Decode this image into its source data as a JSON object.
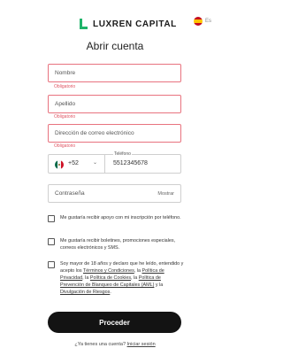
{
  "header": {
    "brand": "LUXREN CAPITAL",
    "language": "Es"
  },
  "form": {
    "title": "Abrir cuenta",
    "first_name": {
      "placeholder": "Nombre",
      "error": "Obligatorio"
    },
    "last_name": {
      "placeholder": "Apellido",
      "error": "Obligatorio"
    },
    "email": {
      "placeholder": "Dirección de correo electrónico",
      "error": "Obligatorio"
    },
    "phone": {
      "country_code": "+52",
      "label": "Teléfono",
      "value": "5512345678"
    },
    "password": {
      "placeholder": "Contraseña",
      "toggle": "Mostrar"
    },
    "checkbox_1": {
      "text": "Me gustaría recibir apoyo con mi inscripción por teléfono.",
      "checked": false
    },
    "checkbox_2": {
      "text": "Me gustaría recibir boletines, promociones especiales, correos electrónicos y SMS.",
      "checked": false
    },
    "checkbox_3": {
      "checked": false,
      "part1": "Soy mayor de 18 años y declaro que he leído, entendido y acepto los ",
      "link_terms": "Términos y Condiciones",
      "part2": ", la ",
      "link_privacy": "Política de Privacidad",
      "part3": ", la ",
      "link_cookies": "Política de Cookies",
      "part4": ", la ",
      "link_aml": "Política de Prevención de Blanqueo de Capitales (AML)",
      "part5": " y la ",
      "link_risk": "Divulgación de Riesgos",
      "part6": "."
    },
    "submit": "Proceder"
  },
  "footer": {
    "question": "¿Ya tienes una cuenta?",
    "login": "Iniciar sesión"
  },
  "colors": {
    "brand_green": "#1fb46a",
    "error": "#e05563",
    "button": "#131313"
  }
}
